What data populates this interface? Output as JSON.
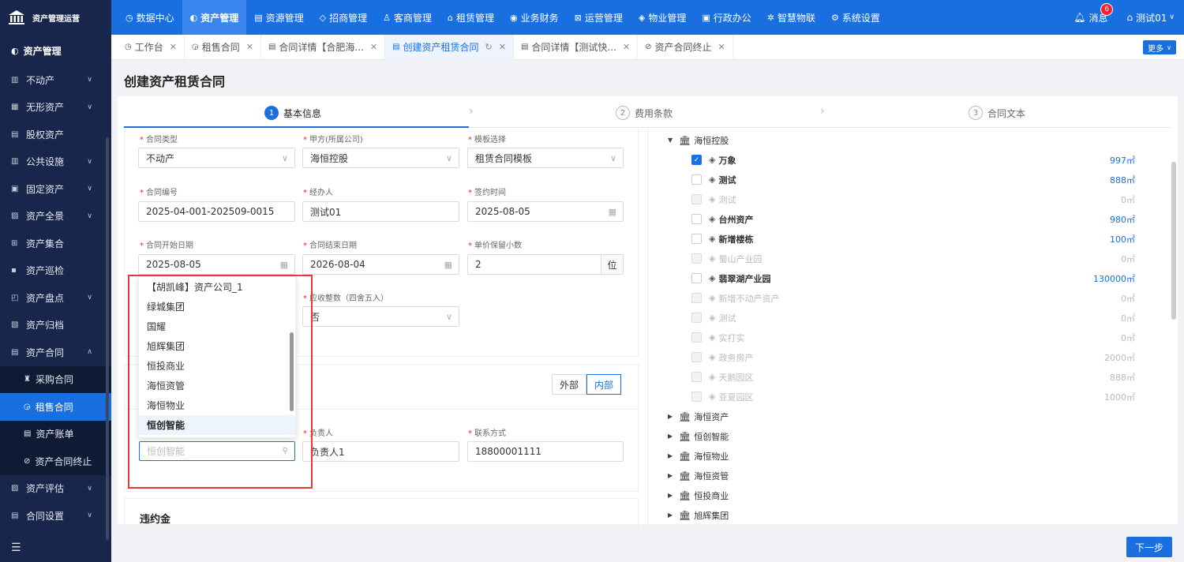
{
  "app": {
    "title": "资产管理运营"
  },
  "topnav": {
    "items": [
      {
        "icon": "◷",
        "label": "数据中心"
      },
      {
        "icon": "◐",
        "label": "资产管理"
      },
      {
        "icon": "▤",
        "label": "资源管理"
      },
      {
        "icon": "◇",
        "label": "招商管理"
      },
      {
        "icon": "♙",
        "label": "客商管理"
      },
      {
        "icon": "⌂",
        "label": "租赁管理"
      },
      {
        "icon": "◉",
        "label": "业务财务"
      },
      {
        "icon": "⊠",
        "label": "运营管理"
      },
      {
        "icon": "◈",
        "label": "物业管理"
      },
      {
        "icon": "▣",
        "label": "行政办公"
      },
      {
        "icon": "✲",
        "label": "智慧物联"
      },
      {
        "icon": "⚙",
        "label": "系统设置"
      }
    ],
    "messages_label": "消息",
    "messages_count": "6",
    "user_label": "测试01"
  },
  "sidebar": {
    "header": "资产管理",
    "items": [
      {
        "icon": "▥",
        "label": "不动产"
      },
      {
        "icon": "▦",
        "label": "无形资产"
      },
      {
        "icon": "▤",
        "label": "股权资产"
      },
      {
        "icon": "▥",
        "label": "公共设施"
      },
      {
        "icon": "▣",
        "label": "固定资产"
      },
      {
        "icon": "▨",
        "label": "资产全景"
      },
      {
        "icon": "⊞",
        "label": "资产集合"
      },
      {
        "icon": "▪",
        "label": "资产巡检"
      },
      {
        "icon": "◰",
        "label": "资产盘点"
      },
      {
        "icon": "▧",
        "label": "资产归档"
      },
      {
        "icon": "▤",
        "label": "资产合同"
      }
    ],
    "subitems": [
      {
        "icon": "♜",
        "label": "采购合同"
      },
      {
        "icon": "◶",
        "label": "租售合同"
      },
      {
        "icon": "▤",
        "label": "资产账单"
      },
      {
        "icon": "⊘",
        "label": "资产合同终止"
      }
    ],
    "after": [
      {
        "icon": "▨",
        "label": "资产评估"
      },
      {
        "icon": "▤",
        "label": "合同设置"
      }
    ]
  },
  "tabs": {
    "items": [
      {
        "icon": "◷",
        "label": "工作台"
      },
      {
        "icon": "◶",
        "label": "租售合同"
      },
      {
        "icon": "▤",
        "label": "合同详情【合肥海..."
      },
      {
        "icon": "▤",
        "label": "创建资产租赁合同"
      },
      {
        "icon": "▤",
        "label": "合同详情【测试快..."
      },
      {
        "icon": "⊘",
        "label": "资产合同终止"
      }
    ],
    "more_label": "更多"
  },
  "page": {
    "title": "创建资产租赁合同"
  },
  "steps": [
    {
      "num": "1",
      "label": "基本信息"
    },
    {
      "num": "2",
      "label": "费用条款"
    },
    {
      "num": "3",
      "label": "合同文本"
    }
  ],
  "form": {
    "contract_type": {
      "label": "合同类型",
      "value": "不动产"
    },
    "party_a": {
      "label": "甲方(所属公司)",
      "value": "海恒控股"
    },
    "template": {
      "label": "模板选择",
      "value": "租赁合同模板"
    },
    "contract_no": {
      "label": "合同编号",
      "value": "2025-04-001-202509-0015"
    },
    "handler": {
      "label": "经办人",
      "value": "测试01"
    },
    "sign_date": {
      "label": "签约时间",
      "value": "2025-08-05"
    },
    "start_date": {
      "label": "合同开始日期",
      "value": "2025-08-05"
    },
    "end_date": {
      "label": "合同结束日期",
      "value": "2026-08-04"
    },
    "decimals": {
      "label": "单价保留小数",
      "value": "2",
      "unit": "位"
    },
    "rounding": {
      "label": "应收整数（四舍五入）",
      "value": "否"
    },
    "party_type": {
      "outer": "外部",
      "inner": "内部"
    },
    "owner": {
      "label": "负责人",
      "value": "负责人1"
    },
    "contact": {
      "label": "联系方式",
      "value": "18800001111"
    },
    "penalty_title": "违约金"
  },
  "dropdown": {
    "options": [
      "【胡凯峰】资产公司_1",
      "绿城集团",
      "国耀",
      "旭辉集团",
      "恒投商业",
      "海恒资管",
      "海恒物业",
      "恒创智能"
    ],
    "selected": "恒创智能",
    "search_placeholder": "恒创智能"
  },
  "tree": {
    "root": "海恒控股",
    "leaves": [
      {
        "label": "万象",
        "value": "997㎡",
        "checked": true,
        "disabled": false
      },
      {
        "label": "测试",
        "value": "888㎡",
        "checked": false,
        "disabled": false
      },
      {
        "label": "测试",
        "value": "0㎡",
        "checked": false,
        "disabled": true
      },
      {
        "label": "台州资产",
        "value": "980㎡",
        "checked": false,
        "disabled": false
      },
      {
        "label": "新增楼栋",
        "value": "100㎡",
        "checked": false,
        "disabled": false
      },
      {
        "label": "蜀山产业园",
        "value": "0㎡",
        "checked": false,
        "disabled": true
      },
      {
        "label": "翡翠湖产业园",
        "value": "130000㎡",
        "checked": false,
        "disabled": false
      },
      {
        "label": "新增不动产资产",
        "value": "0㎡",
        "checked": false,
        "disabled": true
      },
      {
        "label": "测试",
        "value": "0㎡",
        "checked": false,
        "disabled": true
      },
      {
        "label": "实打实",
        "value": "0㎡",
        "checked": false,
        "disabled": true
      },
      {
        "label": "政务房产",
        "value": "2000㎡",
        "checked": false,
        "disabled": true
      },
      {
        "label": "天鹅园区",
        "value": "888㎡",
        "checked": false,
        "disabled": true
      },
      {
        "label": "亚夏园区",
        "value": "1000㎡",
        "checked": false,
        "disabled": true
      }
    ],
    "others": [
      "海恒资产",
      "恒创智能",
      "海恒物业",
      "海恒资管",
      "恒投商业",
      "旭辉集团"
    ]
  },
  "footer": {
    "next_label": "下一步"
  }
}
